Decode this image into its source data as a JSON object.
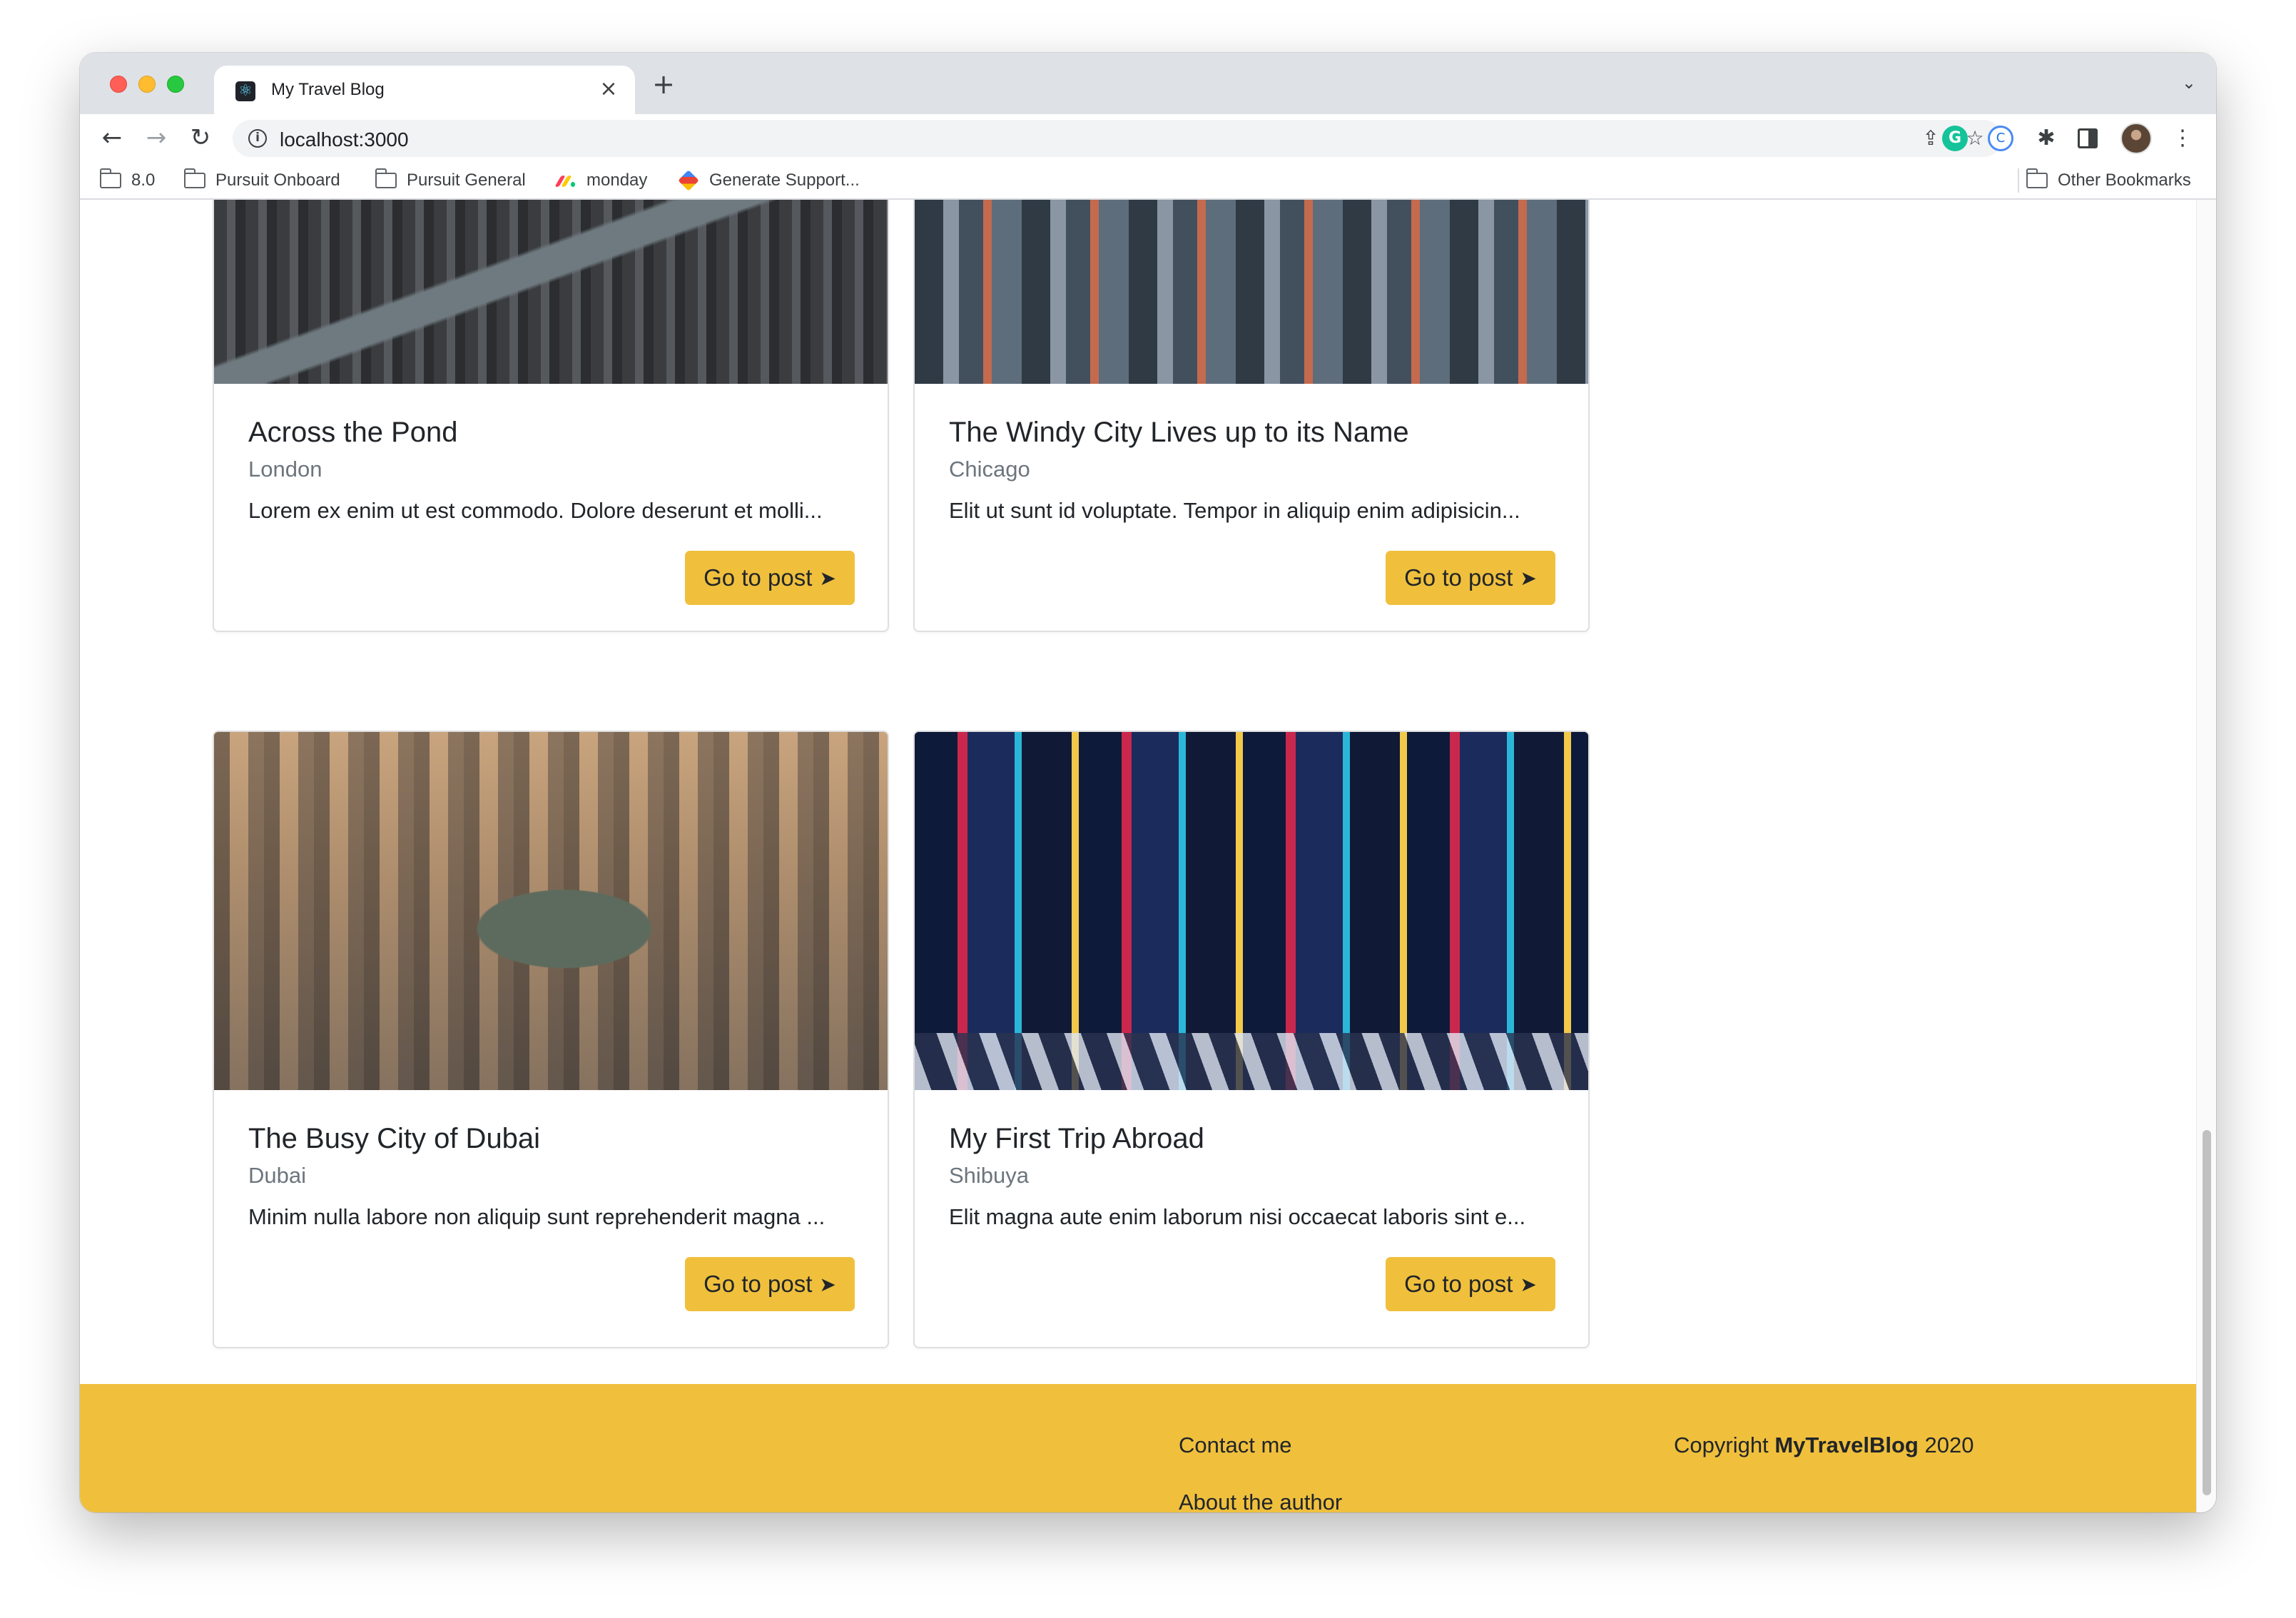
{
  "browser": {
    "tab_title": "My Travel Blog",
    "tab_close": "×",
    "new_tab": "+",
    "url": "localhost:3000",
    "bookmarks": [
      {
        "label": "8.0",
        "icon": "folder-icon"
      },
      {
        "label": "Pursuit Onboard",
        "icon": "folder-icon"
      },
      {
        "label": "Pursuit General",
        "icon": "folder-icon"
      },
      {
        "label": "monday",
        "icon": "monday-icon"
      },
      {
        "label": "Generate Support...",
        "icon": "generate-support-icon"
      }
    ],
    "other_bookmarks": "Other Bookmarks"
  },
  "posts": [
    {
      "title": "Across the Pond",
      "location": "London",
      "excerpt": "Lorem ex enim ut est commodo. Dolore deserunt et molli...",
      "button": "Go to post",
      "image": "london-aerial"
    },
    {
      "title": "The Windy City Lives up to its Name",
      "location": "Chicago",
      "excerpt": "Elit ut sunt id voluptate. Tempor in aliquip enim adipisicin...",
      "button": "Go to post",
      "image": "chicago-skyline"
    },
    {
      "title": "The Busy City of Dubai",
      "location": "Dubai",
      "excerpt": "Minim nulla labore non aliquip sunt reprehenderit magna ...",
      "button": "Go to post",
      "image": "dubai-aerial"
    },
    {
      "title": "My First Trip Abroad",
      "location": "Shibuya",
      "excerpt": "Elit magna aute enim laborum nisi occaecat laboris sint e...",
      "button": "Go to post",
      "image": "shibuya-crossing"
    }
  ],
  "footer": {
    "contact": "Contact me",
    "about": "About the author",
    "copyright_prefix": "Copyright",
    "copyright_brand": "MyTravelBlog",
    "copyright_year": "2020"
  },
  "colors": {
    "accent": "#f0c03d",
    "text": "#212529",
    "muted": "#6c757d"
  }
}
